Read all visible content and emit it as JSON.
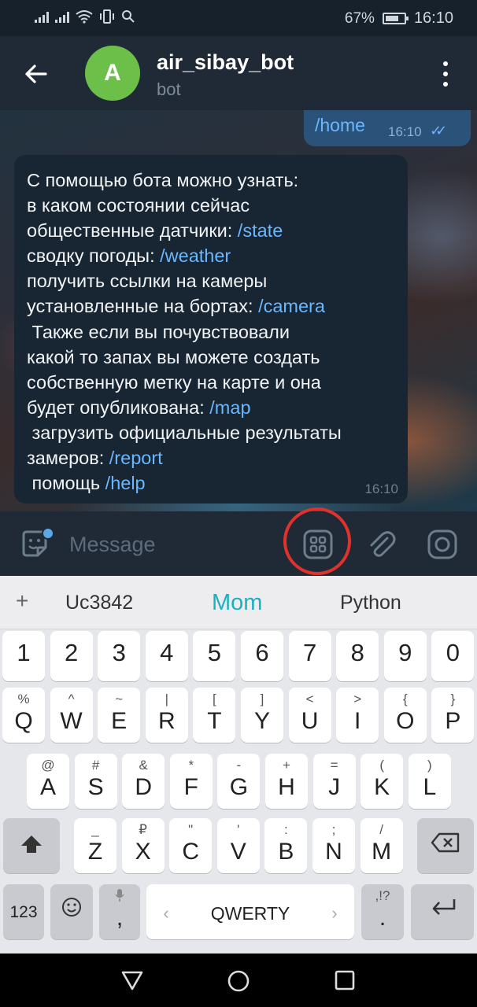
{
  "status_bar": {
    "battery_percent": "67%",
    "time": "16:10",
    "icons": [
      "signal-icon",
      "signal-icon",
      "wifi-icon",
      "vibrate-icon",
      "search-icon",
      "battery-icon"
    ]
  },
  "header": {
    "avatar_letter": "A",
    "title": "air_sibay_bot",
    "subtitle": "bot"
  },
  "messages": {
    "outgoing": {
      "text": "/home",
      "time": "16:10",
      "status": "read"
    },
    "incoming": {
      "time": "16:10",
      "lines": [
        {
          "text": "С помощью бота можно узнать:",
          "cmd": ""
        },
        {
          "text": "в каком состоянии сейчас",
          "cmd": ""
        },
        {
          "text": "общественные датчики: ",
          "cmd": "/state"
        },
        {
          "text": "сводку погоды: ",
          "cmd": "/weather"
        },
        {
          "text": "получить ссылки на камеры",
          "cmd": ""
        },
        {
          "text": "установленные на бортах: ",
          "cmd": "/camera"
        },
        {
          "text": " Также если вы почувствовали",
          "cmd": ""
        },
        {
          "text": "какой то запах вы можете создать",
          "cmd": ""
        },
        {
          "text": "собственную метку на карте и она",
          "cmd": ""
        },
        {
          "text": "будет опубликована: ",
          "cmd": "/map"
        },
        {
          "text": " загрузить официальные результаты",
          "cmd": ""
        },
        {
          "text": "замеров: ",
          "cmd": "/report"
        },
        {
          "text": " помощь ",
          "cmd": "/help"
        }
      ]
    }
  },
  "input_bar": {
    "placeholder": "Message"
  },
  "keyboard": {
    "suggestions": [
      "+",
      "Uc3842",
      "Mom",
      "Python"
    ],
    "number_row": [
      "1",
      "2",
      "3",
      "4",
      "5",
      "6",
      "7",
      "8",
      "9",
      "0"
    ],
    "row1": [
      {
        "main": "Q",
        "sub": "%"
      },
      {
        "main": "W",
        "sub": "^"
      },
      {
        "main": "E",
        "sub": "~"
      },
      {
        "main": "R",
        "sub": "|"
      },
      {
        "main": "T",
        "sub": "["
      },
      {
        "main": "Y",
        "sub": "]"
      },
      {
        "main": "U",
        "sub": "<"
      },
      {
        "main": "I",
        "sub": ">"
      },
      {
        "main": "O",
        "sub": "{"
      },
      {
        "main": "P",
        "sub": "}"
      }
    ],
    "row2": [
      {
        "main": "A",
        "sub": "@"
      },
      {
        "main": "S",
        "sub": "#"
      },
      {
        "main": "D",
        "sub": "&"
      },
      {
        "main": "F",
        "sub": "*"
      },
      {
        "main": "G",
        "sub": "-"
      },
      {
        "main": "H",
        "sub": "+"
      },
      {
        "main": "J",
        "sub": "="
      },
      {
        "main": "K",
        "sub": "("
      },
      {
        "main": "L",
        "sub": ")"
      }
    ],
    "row3": [
      {
        "main": "Z",
        "sub": "_"
      },
      {
        "main": "X",
        "sub": "₽"
      },
      {
        "main": "C",
        "sub": "\""
      },
      {
        "main": "V",
        "sub": "'"
      },
      {
        "main": "B",
        "sub": ":"
      },
      {
        "main": "N",
        "sub": ";"
      },
      {
        "main": "M",
        "sub": "/"
      }
    ],
    "bottom": {
      "sym_label": "123",
      "emoji_icon": "smiley-icon",
      "mic_dot": ",",
      "space_label": "QWERTY",
      "space_left": "‹",
      "space_right": "›",
      "punct_sub": ",!?",
      "punct_main": "."
    }
  },
  "colors": {
    "accent_link": "#6ab7ff",
    "outgoing_bubble": "#2b5278",
    "incoming_bubble": "#182533",
    "avatar": "#6cc04a",
    "highlight": "#e0322b",
    "suggestion_active": "#1ab1c1"
  }
}
